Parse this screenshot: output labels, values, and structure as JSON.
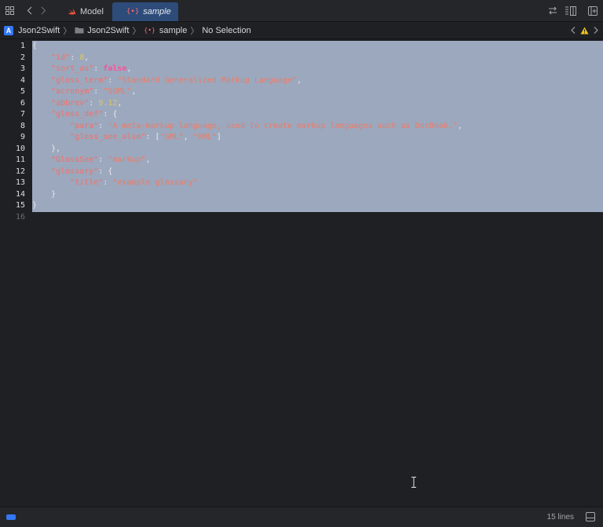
{
  "tabs": [
    {
      "label": "Model",
      "icon": "swift-file-icon",
      "active": false
    },
    {
      "label": "sample",
      "icon": "json-file-icon",
      "active": true
    }
  ],
  "breadcrumb": {
    "project": "Json2Swift",
    "folder": "Json2Swift",
    "file": "sample",
    "selection": "No Selection"
  },
  "editor": {
    "line_numbers": [
      "1",
      "2",
      "3",
      "4",
      "5",
      "6",
      "7",
      "8",
      "9",
      "10",
      "11",
      "12",
      "13",
      "14",
      "15",
      "16"
    ],
    "lines": [
      [
        {
          "t": "p",
          "v": "{"
        }
      ],
      [
        {
          "t": "p",
          "v": "    "
        },
        {
          "t": "k",
          "v": "\"id\""
        },
        {
          "t": "p",
          "v": ": "
        },
        {
          "t": "n",
          "v": "8"
        },
        {
          "t": "p",
          "v": ","
        }
      ],
      [
        {
          "t": "p",
          "v": "    "
        },
        {
          "t": "k",
          "v": "\"sort_as\""
        },
        {
          "t": "p",
          "v": ": "
        },
        {
          "t": "kw",
          "v": "false"
        },
        {
          "t": "p",
          "v": ","
        }
      ],
      [
        {
          "t": "p",
          "v": "    "
        },
        {
          "t": "k",
          "v": "\"gloss_term\""
        },
        {
          "t": "p",
          "v": ": "
        },
        {
          "t": "s",
          "v": "\"Standard Generalized Markup Language\""
        },
        {
          "t": "p",
          "v": ","
        }
      ],
      [
        {
          "t": "p",
          "v": "    "
        },
        {
          "t": "k",
          "v": "\"acronym\""
        },
        {
          "t": "p",
          "v": ": "
        },
        {
          "t": "s",
          "v": "\"SGML\""
        },
        {
          "t": "p",
          "v": ","
        }
      ],
      [
        {
          "t": "p",
          "v": "    "
        },
        {
          "t": "k",
          "v": "\"abbrev\""
        },
        {
          "t": "p",
          "v": ": "
        },
        {
          "t": "n",
          "v": "9.12"
        },
        {
          "t": "p",
          "v": ","
        }
      ],
      [
        {
          "t": "p",
          "v": "    "
        },
        {
          "t": "k",
          "v": "\"gloss_def\""
        },
        {
          "t": "p",
          "v": ": {"
        }
      ],
      [
        {
          "t": "p",
          "v": "        "
        },
        {
          "t": "k",
          "v": "\"para\""
        },
        {
          "t": "p",
          "v": ": "
        },
        {
          "t": "s",
          "v": "\"A meta-markup language, used to create markup languages such as DocBook.\""
        },
        {
          "t": "p",
          "v": ","
        }
      ],
      [
        {
          "t": "p",
          "v": "        "
        },
        {
          "t": "k",
          "v": "\"gloss_see_also\""
        },
        {
          "t": "p",
          "v": ": ["
        },
        {
          "t": "s",
          "v": "\"GML\""
        },
        {
          "t": "p",
          "v": ", "
        },
        {
          "t": "s",
          "v": "\"XML\""
        },
        {
          "t": "p",
          "v": "]"
        }
      ],
      [
        {
          "t": "p",
          "v": "    },"
        }
      ],
      [
        {
          "t": "p",
          "v": "    "
        },
        {
          "t": "k",
          "v": "\"GlossSee\""
        },
        {
          "t": "p",
          "v": ": "
        },
        {
          "t": "s",
          "v": "\"markup\""
        },
        {
          "t": "p",
          "v": ","
        }
      ],
      [
        {
          "t": "p",
          "v": "    "
        },
        {
          "t": "k",
          "v": "\"glossary\""
        },
        {
          "t": "p",
          "v": ": {"
        }
      ],
      [
        {
          "t": "p",
          "v": "        "
        },
        {
          "t": "k",
          "v": "\"title\""
        },
        {
          "t": "p",
          "v": ": "
        },
        {
          "t": "s",
          "v": "\"example glossary\""
        }
      ],
      [
        {
          "t": "p",
          "v": "    }"
        }
      ],
      [
        {
          "t": "p",
          "v": "}"
        }
      ]
    ],
    "selection_color": "#9ca8bd"
  },
  "status": {
    "line_count": "15 lines"
  },
  "colors": {
    "background": "#1f2024",
    "accent": "#3478f6",
    "active_tab": "#2d4c7a",
    "json_key": "#f2706a",
    "json_string": "#f07a66",
    "json_number": "#d9c86a",
    "json_keyword": "#ff4f9a",
    "warning": "#f5c518"
  }
}
